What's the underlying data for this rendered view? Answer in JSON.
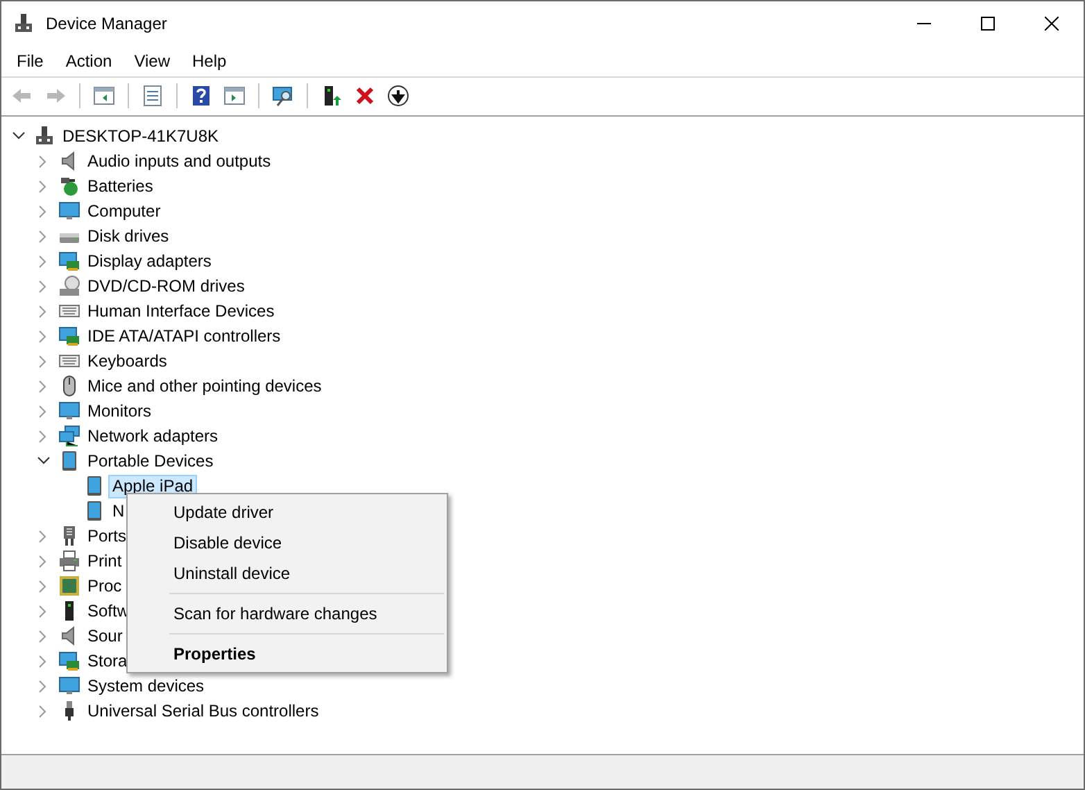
{
  "window": {
    "title": "Device Manager"
  },
  "menu_bar": [
    "File",
    "Action",
    "View",
    "Help"
  ],
  "toolbar": [
    {
      "kind": "back",
      "disabled": true
    },
    {
      "kind": "forward",
      "disabled": true
    },
    {
      "kind": "separator"
    },
    {
      "kind": "pane",
      "disabled": false
    },
    {
      "kind": "separator"
    },
    {
      "kind": "properties",
      "disabled": false
    },
    {
      "kind": "separator"
    },
    {
      "kind": "help",
      "disabled": false
    },
    {
      "kind": "pane2",
      "disabled": false
    },
    {
      "kind": "separator"
    },
    {
      "kind": "scan",
      "disabled": false
    },
    {
      "kind": "separator"
    },
    {
      "kind": "update",
      "disabled": false
    },
    {
      "kind": "uninstall",
      "disabled": false
    },
    {
      "kind": "download",
      "disabled": false
    }
  ],
  "tree": {
    "label": "DESKTOP-41K7U8K",
    "kind": "computer-root",
    "expanded": true,
    "children": [
      {
        "label": "Audio inputs and outputs",
        "kind": "speaker",
        "expanded": false
      },
      {
        "label": "Batteries",
        "kind": "battery",
        "expanded": false
      },
      {
        "label": "Computer",
        "kind": "monitor",
        "expanded": false
      },
      {
        "label": "Disk drives",
        "kind": "drive",
        "expanded": false
      },
      {
        "label": "Display adapters",
        "kind": "card",
        "expanded": false
      },
      {
        "label": "DVD/CD-ROM drives",
        "kind": "disc",
        "expanded": false
      },
      {
        "label": "Human Interface Devices",
        "kind": "keyboard",
        "expanded": false
      },
      {
        "label": "IDE ATA/ATAPI controllers",
        "kind": "card",
        "expanded": false
      },
      {
        "label": "Keyboards",
        "kind": "keyboard",
        "expanded": false
      },
      {
        "label": "Mice and other pointing devices",
        "kind": "mouse",
        "expanded": false
      },
      {
        "label": "Monitors",
        "kind": "monitor",
        "expanded": false
      },
      {
        "label": "Network adapters",
        "kind": "network",
        "expanded": false
      },
      {
        "label": "Portable Devices",
        "kind": "tablet",
        "expanded": true,
        "children": [
          {
            "label": "Apple iPad",
            "kind": "tablet",
            "selected": true
          },
          {
            "label": "N",
            "kind": "tablet",
            "selected": false
          }
        ]
      },
      {
        "label": "Ports",
        "kind": "port",
        "expanded": false
      },
      {
        "label": "Print",
        "kind": "printer",
        "expanded": false
      },
      {
        "label": "Proc",
        "kind": "chip",
        "expanded": false
      },
      {
        "label": "Softw",
        "kind": "tower",
        "expanded": false
      },
      {
        "label": "Sour",
        "kind": "speaker",
        "expanded": false
      },
      {
        "label": "Stora",
        "kind": "card",
        "expanded": false
      },
      {
        "label": "System devices",
        "kind": "monitor",
        "expanded": false
      },
      {
        "label": "Universal Serial Bus controllers",
        "kind": "usb",
        "expanded": false
      }
    ]
  },
  "context_menu": [
    {
      "kind": "item",
      "label": "Update driver"
    },
    {
      "kind": "item",
      "label": "Disable device"
    },
    {
      "kind": "item",
      "label": "Uninstall device"
    },
    {
      "kind": "separator"
    },
    {
      "kind": "item",
      "label": "Scan for hardware changes"
    },
    {
      "kind": "separator"
    },
    {
      "kind": "default",
      "label": "Properties"
    }
  ]
}
